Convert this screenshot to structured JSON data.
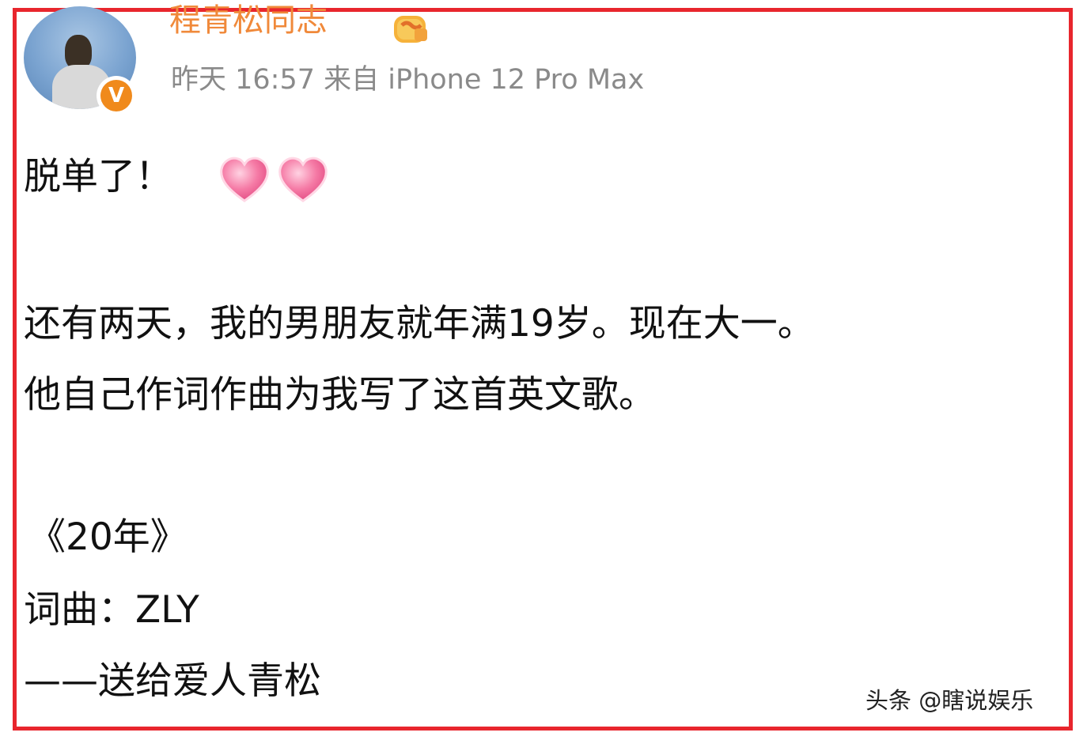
{
  "post": {
    "author": "程青松同志",
    "meta": "昨天 16:57 来自 iPhone 12 Pro Max",
    "verified_badge": "V",
    "lines": [
      "脱单了！",
      "还有两天，我的男朋友就年满19岁。现在大一。",
      "他自己作词作曲为我写了这首英文歌。",
      "《20年》",
      "词曲：ZLY",
      "——送给爱人青松"
    ],
    "emoji": [
      "pink-heart-icon",
      "pink-heart-icon"
    ]
  },
  "watermark": "头条 @瞎说娱乐",
  "colors": {
    "frame": "#e8262d",
    "author": "#f0893a",
    "meta": "#8a8a8a",
    "badge": "#f08a1c",
    "heart": "#f06e9c"
  }
}
